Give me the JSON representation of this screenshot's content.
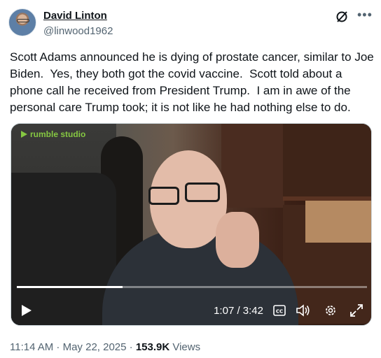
{
  "author": {
    "name": "David Linton",
    "handle": "@linwood1962"
  },
  "icons": {
    "grok": "grok-icon",
    "more": "more-icon",
    "play": "play-icon",
    "captions": "cc-icon",
    "volume": "volume-icon",
    "settings": "gear-icon",
    "fullscreen": "expand-icon"
  },
  "tweet": {
    "text": "Scott Adams announced he is dying of prostate cancer, similar to Joe Biden.  Yes, they both got the covid vaccine.  Scott told about a phone call he received from President Trump.  I am in awe of the personal care Trump took; it is not like he had nothing else to do."
  },
  "video": {
    "brand_label": "rumble studio",
    "brand_color": "#85c742",
    "time_display": "1:07 / 3:42",
    "progress_fraction": 0.302
  },
  "meta": {
    "timestamp": "11:14 AM · May 22, 2025 · ",
    "views_count": "153.9K",
    "views_label": " Views"
  }
}
